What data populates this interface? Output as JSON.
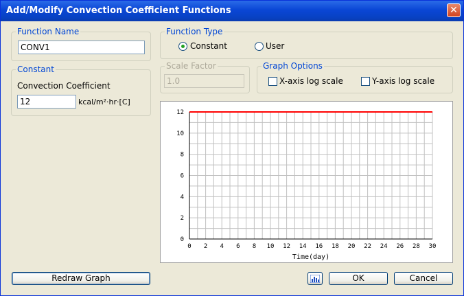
{
  "window": {
    "title": "Add/Modify Convection Coefficient Functions",
    "close_glyph": "✕"
  },
  "function_name": {
    "legend": "Function Name",
    "value": "CONV1"
  },
  "function_type": {
    "legend": "Function Type",
    "options": [
      {
        "label": "Constant",
        "selected": true
      },
      {
        "label": "User",
        "selected": false
      }
    ]
  },
  "constant": {
    "legend": "Constant",
    "field_label": "Convection Coefficient",
    "value": "12",
    "unit": "kcal/m²·hr·[C]"
  },
  "scale_factor": {
    "legend": "Scale Factor",
    "value": "1.0"
  },
  "graph_options": {
    "legend": "Graph Options",
    "x_log_label": "X-axis log scale",
    "y_log_label": "Y-axis log scale",
    "x_log_checked": false,
    "y_log_checked": false
  },
  "buttons": {
    "redraw": "Redraw Graph",
    "ok": "OK",
    "cancel": "Cancel",
    "graph_icon": "bar-chart-icon"
  },
  "colors": {
    "series_line": "#ff0000",
    "grid": "#c0c0c0",
    "accent_blue": "#0046d5"
  },
  "chart_data": {
    "type": "line",
    "title": "",
    "xlabel": "Time(day)",
    "ylabel": "",
    "xlim": [
      0,
      30
    ],
    "ylim": [
      0,
      12
    ],
    "x_ticks": [
      0,
      2,
      4,
      6,
      8,
      10,
      12,
      14,
      16,
      18,
      20,
      22,
      24,
      26,
      28,
      30
    ],
    "y_ticks": [
      0,
      2,
      4,
      6,
      8,
      10,
      12
    ],
    "x_grid_step": 1,
    "y_grid_step": 1,
    "grid": true,
    "series": [
      {
        "x": [
          0,
          30
        ],
        "y": [
          12,
          12
        ],
        "color": "#ff0000"
      }
    ]
  }
}
